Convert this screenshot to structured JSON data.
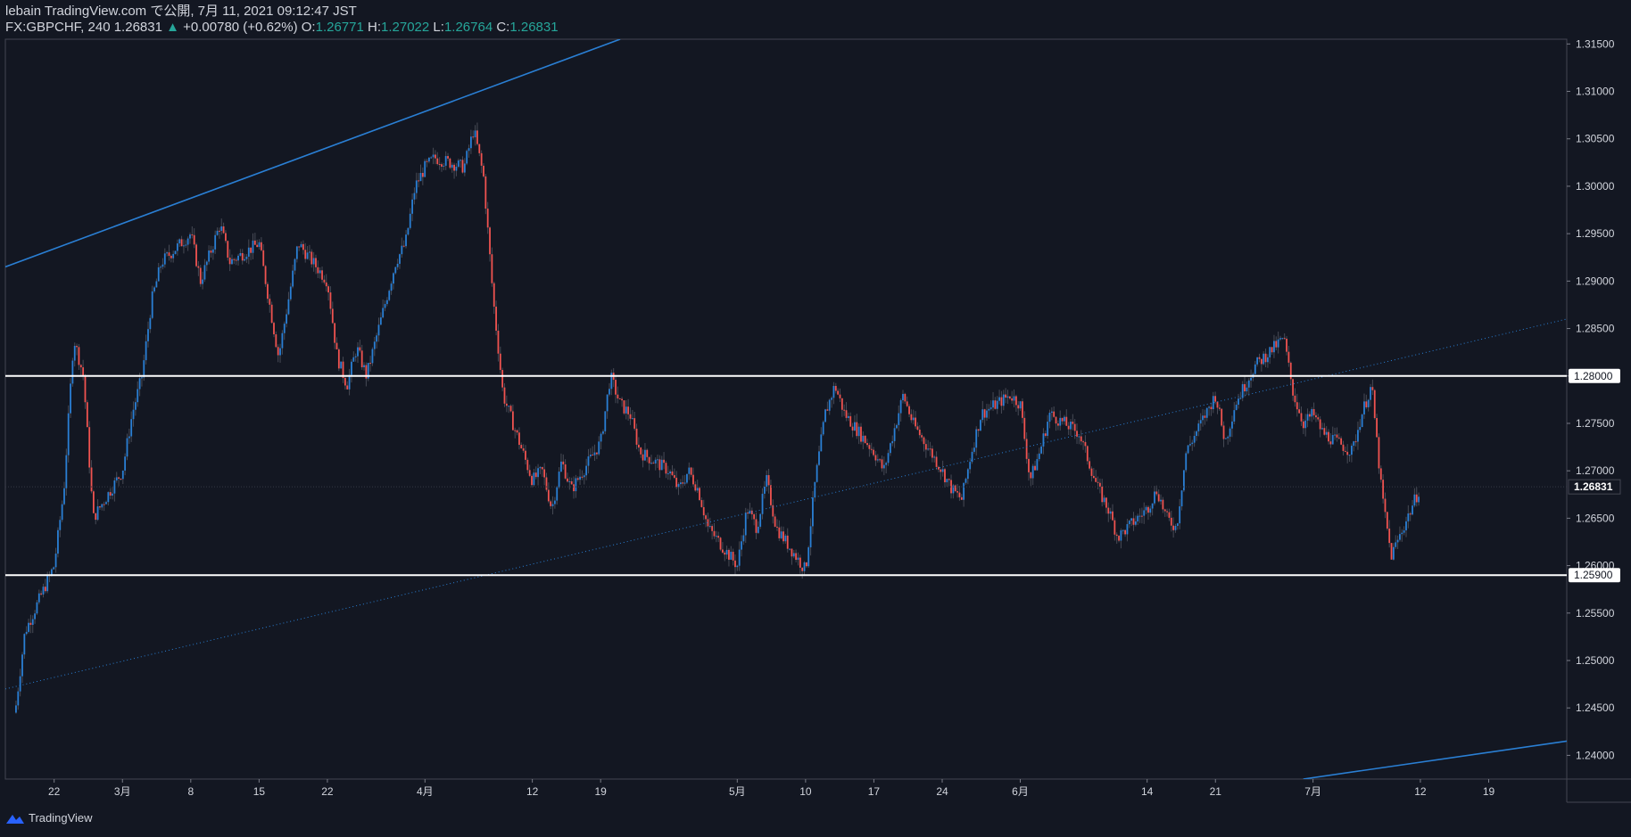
{
  "header": {
    "publisher_line": "lebain TradingView.com で公開, 7月 11, 2021 09:12:47 JST",
    "symbol": "FX:GBPCHF, 240",
    "last": "1.26831",
    "change_arrow": "▲",
    "change": "+0.00780 (+0.62%)",
    "o_label": "O:",
    "o_value": "1.26771",
    "h_label": "H:",
    "h_value": "1.27022",
    "l_label": "L:",
    "l_value": "1.26764",
    "c_label": "C:",
    "c_value": "1.26831"
  },
  "footer": {
    "brand": "TradingView"
  },
  "colors": {
    "background": "#131722",
    "up": "#2a7fd4",
    "down": "#ef5350",
    "trendline": "#2a7fd4",
    "level": "#ffffff",
    "axis_text": "#d1d4dc"
  },
  "chart_data": {
    "type": "candlestick",
    "symbol": "FX:GBPCHF",
    "interval": "240",
    "ylim": [
      1.2375,
      1.3155
    ],
    "y_ticks": [
      "1.31500",
      "1.31000",
      "1.30500",
      "1.30000",
      "1.29500",
      "1.29000",
      "1.28500",
      "1.28000",
      "1.27500",
      "1.27000",
      "1.26500",
      "1.26000",
      "1.25500",
      "1.25000",
      "1.24500",
      "1.24000"
    ],
    "x_ticks": [
      {
        "label": "22",
        "date": "2021-02-22"
      },
      {
        "label": "3月",
        "date": "2021-03-01"
      },
      {
        "label": "8",
        "date": "2021-03-08"
      },
      {
        "label": "15",
        "date": "2021-03-15"
      },
      {
        "label": "22",
        "date": "2021-03-22"
      },
      {
        "label": "4月",
        "date": "2021-04-01"
      },
      {
        "label": "12",
        "date": "2021-04-12"
      },
      {
        "label": "19",
        "date": "2021-04-19"
      },
      {
        "label": "5月",
        "date": "2021-05-03"
      },
      {
        "label": "10",
        "date": "2021-05-10"
      },
      {
        "label": "17",
        "date": "2021-05-17"
      },
      {
        "label": "24",
        "date": "2021-05-24"
      },
      {
        "label": "6月",
        "date": "2021-06-01"
      },
      {
        "label": "14",
        "date": "2021-06-14"
      },
      {
        "label": "21",
        "date": "2021-06-21"
      },
      {
        "label": "7月",
        "date": "2021-07-01"
      },
      {
        "label": "12",
        "date": "2021-07-12"
      },
      {
        "label": "19",
        "date": "2021-07-19"
      }
    ],
    "price_path": [
      [
        "2021-02-18",
        1.2445
      ],
      [
        "2021-02-19",
        1.253
      ],
      [
        "2021-02-22",
        1.26
      ],
      [
        "2021-02-23",
        1.268
      ],
      [
        "2021-02-24",
        1.284
      ],
      [
        "2021-02-25",
        1.28
      ],
      [
        "2021-02-26",
        1.265
      ],
      [
        "2021-03-01",
        1.27
      ],
      [
        "2021-03-02",
        1.276
      ],
      [
        "2021-03-03",
        1.28
      ],
      [
        "2021-03-04",
        1.288
      ],
      [
        "2021-03-05",
        1.292
      ],
      [
        "2021-03-08",
        1.295
      ],
      [
        "2021-03-09",
        1.29
      ],
      [
        "2021-03-10",
        1.293
      ],
      [
        "2021-03-11",
        1.296
      ],
      [
        "2021-03-12",
        1.292
      ],
      [
        "2021-03-15",
        1.294
      ],
      [
        "2021-03-16",
        1.288
      ],
      [
        "2021-03-17",
        1.282
      ],
      [
        "2021-03-18",
        1.288
      ],
      [
        "2021-03-19",
        1.294
      ],
      [
        "2021-03-22",
        1.29
      ],
      [
        "2021-03-23",
        1.282
      ],
      [
        "2021-03-24",
        1.279
      ],
      [
        "2021-03-25",
        1.283
      ],
      [
        "2021-03-26",
        1.28
      ],
      [
        "2021-03-29",
        1.292
      ],
      [
        "2021-03-30",
        1.294
      ],
      [
        "2021-03-31",
        1.3
      ],
      [
        "2021-04-01",
        1.302
      ],
      [
        "2021-04-02",
        1.303
      ],
      [
        "2021-04-05",
        1.302
      ],
      [
        "2021-04-06",
        1.306
      ],
      [
        "2021-04-07",
        1.301
      ],
      [
        "2021-04-08",
        1.288
      ],
      [
        "2021-04-09",
        1.278
      ],
      [
        "2021-04-12",
        1.269
      ],
      [
        "2021-04-13",
        1.27
      ],
      [
        "2021-04-14",
        1.266
      ],
      [
        "2021-04-15",
        1.271
      ],
      [
        "2021-04-16",
        1.268
      ],
      [
        "2021-04-19",
        1.273
      ],
      [
        "2021-04-20",
        1.28
      ],
      [
        "2021-04-21",
        1.277
      ],
      [
        "2021-04-22",
        1.276
      ],
      [
        "2021-04-23",
        1.272
      ],
      [
        "2021-04-26",
        1.27
      ],
      [
        "2021-04-27",
        1.268
      ],
      [
        "2021-04-28",
        1.27
      ],
      [
        "2021-04-29",
        1.268
      ],
      [
        "2021-04-30",
        1.264
      ],
      [
        "2021-05-03",
        1.26
      ],
      [
        "2021-05-04",
        1.266
      ],
      [
        "2021-05-05",
        1.264
      ],
      [
        "2021-05-06",
        1.269
      ],
      [
        "2021-05-07",
        1.264
      ],
      [
        "2021-05-10",
        1.2595
      ],
      [
        "2021-05-11",
        1.269
      ],
      [
        "2021-05-12",
        1.276
      ],
      [
        "2021-05-13",
        1.279
      ],
      [
        "2021-05-14",
        1.276
      ],
      [
        "2021-05-17",
        1.272
      ],
      [
        "2021-05-18",
        1.27
      ],
      [
        "2021-05-19",
        1.274
      ],
      [
        "2021-05-20",
        1.278
      ],
      [
        "2021-05-21",
        1.275
      ],
      [
        "2021-05-24",
        1.27
      ],
      [
        "2021-05-25",
        1.268
      ],
      [
        "2021-05-26",
        1.267
      ],
      [
        "2021-05-27",
        1.272
      ],
      [
        "2021-05-28",
        1.276
      ],
      [
        "2021-05-31",
        1.278
      ],
      [
        "2021-06-01",
        1.277
      ],
      [
        "2021-06-02",
        1.269
      ],
      [
        "2021-06-03",
        1.272
      ],
      [
        "2021-06-04",
        1.276
      ],
      [
        "2021-06-07",
        1.274
      ],
      [
        "2021-06-08",
        1.271
      ],
      [
        "2021-06-09",
        1.268
      ],
      [
        "2021-06-10",
        1.266
      ],
      [
        "2021-06-11",
        1.263
      ],
      [
        "2021-06-14",
        1.266
      ],
      [
        "2021-06-15",
        1.268
      ],
      [
        "2021-06-16",
        1.265
      ],
      [
        "2021-06-17",
        1.264
      ],
      [
        "2021-06-18",
        1.272
      ],
      [
        "2021-06-21",
        1.278
      ],
      [
        "2021-06-22",
        1.273
      ],
      [
        "2021-06-23",
        1.277
      ],
      [
        "2021-06-24",
        1.279
      ],
      [
        "2021-06-25",
        1.281
      ],
      [
        "2021-06-28",
        1.284
      ],
      [
        "2021-06-29",
        1.278
      ],
      [
        "2021-06-30",
        1.275
      ],
      [
        "2021-07-01",
        1.276
      ],
      [
        "2021-07-02",
        1.274
      ],
      [
        "2021-07-05",
        1.272
      ],
      [
        "2021-07-06",
        1.276
      ],
      [
        "2021-07-07",
        1.279
      ],
      [
        "2021-07-08",
        1.268
      ],
      [
        "2021-07-09",
        1.261
      ],
      [
        "2021-07-12",
        1.2683
      ]
    ],
    "current_price": {
      "value": 1.26831,
      "label": "1.26831"
    },
    "horizontal_levels": [
      {
        "value": 1.28,
        "label": "1.28000"
      },
      {
        "value": 1.259,
        "label": "1.25900"
      }
    ],
    "trendlines": [
      {
        "style": "solid",
        "from": [
          "2021-02-17",
          1.2915
        ],
        "to": [
          "2021-04-21",
          1.3155
        ]
      },
      {
        "style": "dotted",
        "from": [
          "2021-02-17",
          1.247
        ],
        "to": [
          "2021-07-27",
          1.286
        ]
      },
      {
        "style": "solid",
        "from": [
          "2021-06-30",
          1.2375
        ],
        "to": [
          "2021-07-27",
          1.2415
        ]
      }
    ]
  }
}
